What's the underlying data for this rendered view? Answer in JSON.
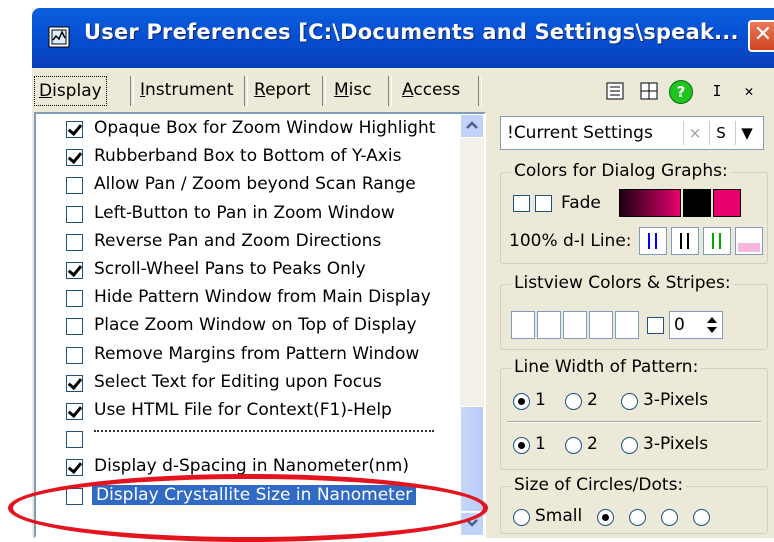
{
  "window": {
    "title": "User Preferences [C:\\Documents and Settings\\speak...",
    "close_glyph": "✕"
  },
  "tabs": [
    {
      "underline": "D",
      "rest": "isplay"
    },
    {
      "underline": "I",
      "rest": "nstrument"
    },
    {
      "underline": "R",
      "rest": "eport"
    },
    {
      "underline": "M",
      "rest": "isc"
    },
    {
      "underline": "A",
      "rest": "ccess"
    }
  ],
  "toolbar": {
    "help_glyph": "?",
    "info_glyph": "I",
    "close_glyph": "✕"
  },
  "options": [
    {
      "label": "Opaque Box for Zoom Window Highlight",
      "checked": true
    },
    {
      "label": "Rubberband Box to Bottom of Y-Axis",
      "checked": true
    },
    {
      "label": "Allow Pan / Zoom beyond Scan Range",
      "checked": false
    },
    {
      "label": "Left-Button to Pan in Zoom Window",
      "checked": false
    },
    {
      "label": "Reverse Pan and Zoom Directions",
      "checked": false
    },
    {
      "label": "Scroll-Wheel Pans to Peaks Only",
      "checked": true
    },
    {
      "label": "Hide Pattern Window from Main Display",
      "checked": false
    },
    {
      "label": "Place Zoom Window on Top of Display",
      "checked": false
    },
    {
      "label": "Remove Margins from Pattern Window",
      "checked": false
    },
    {
      "label": "Select Text for Editing upon Focus",
      "checked": true
    },
    {
      "label": "Use HTML File for Context(F1)-Help",
      "checked": true
    },
    {
      "label": "",
      "checked": false,
      "separator": true
    },
    {
      "label": "Display d-Spacing in Nanometer(nm)",
      "checked": true
    },
    {
      "label": "Display Crystallite Size in Nanometer",
      "checked": false,
      "selected": true
    }
  ],
  "settings": {
    "current": "!Current Settings",
    "x_btn": "×",
    "s_btn": "S",
    "dropdown_glyph": "▼"
  },
  "dialog_colors": {
    "title": "Colors for Dialog Graphs:",
    "fade_label": "Fade",
    "dl_label": "100% d-I Line:",
    "accent_color": "#e8006e"
  },
  "listview": {
    "title": "Listview Colors & Stripes:",
    "spin_value": "0"
  },
  "line_width": {
    "title": "Line Width of Pattern:",
    "opt1": "1",
    "opt2": "2",
    "opt3": "3-Pixels"
  },
  "circles": {
    "title": "Size of Circles/Dots:",
    "small": "Small"
  }
}
